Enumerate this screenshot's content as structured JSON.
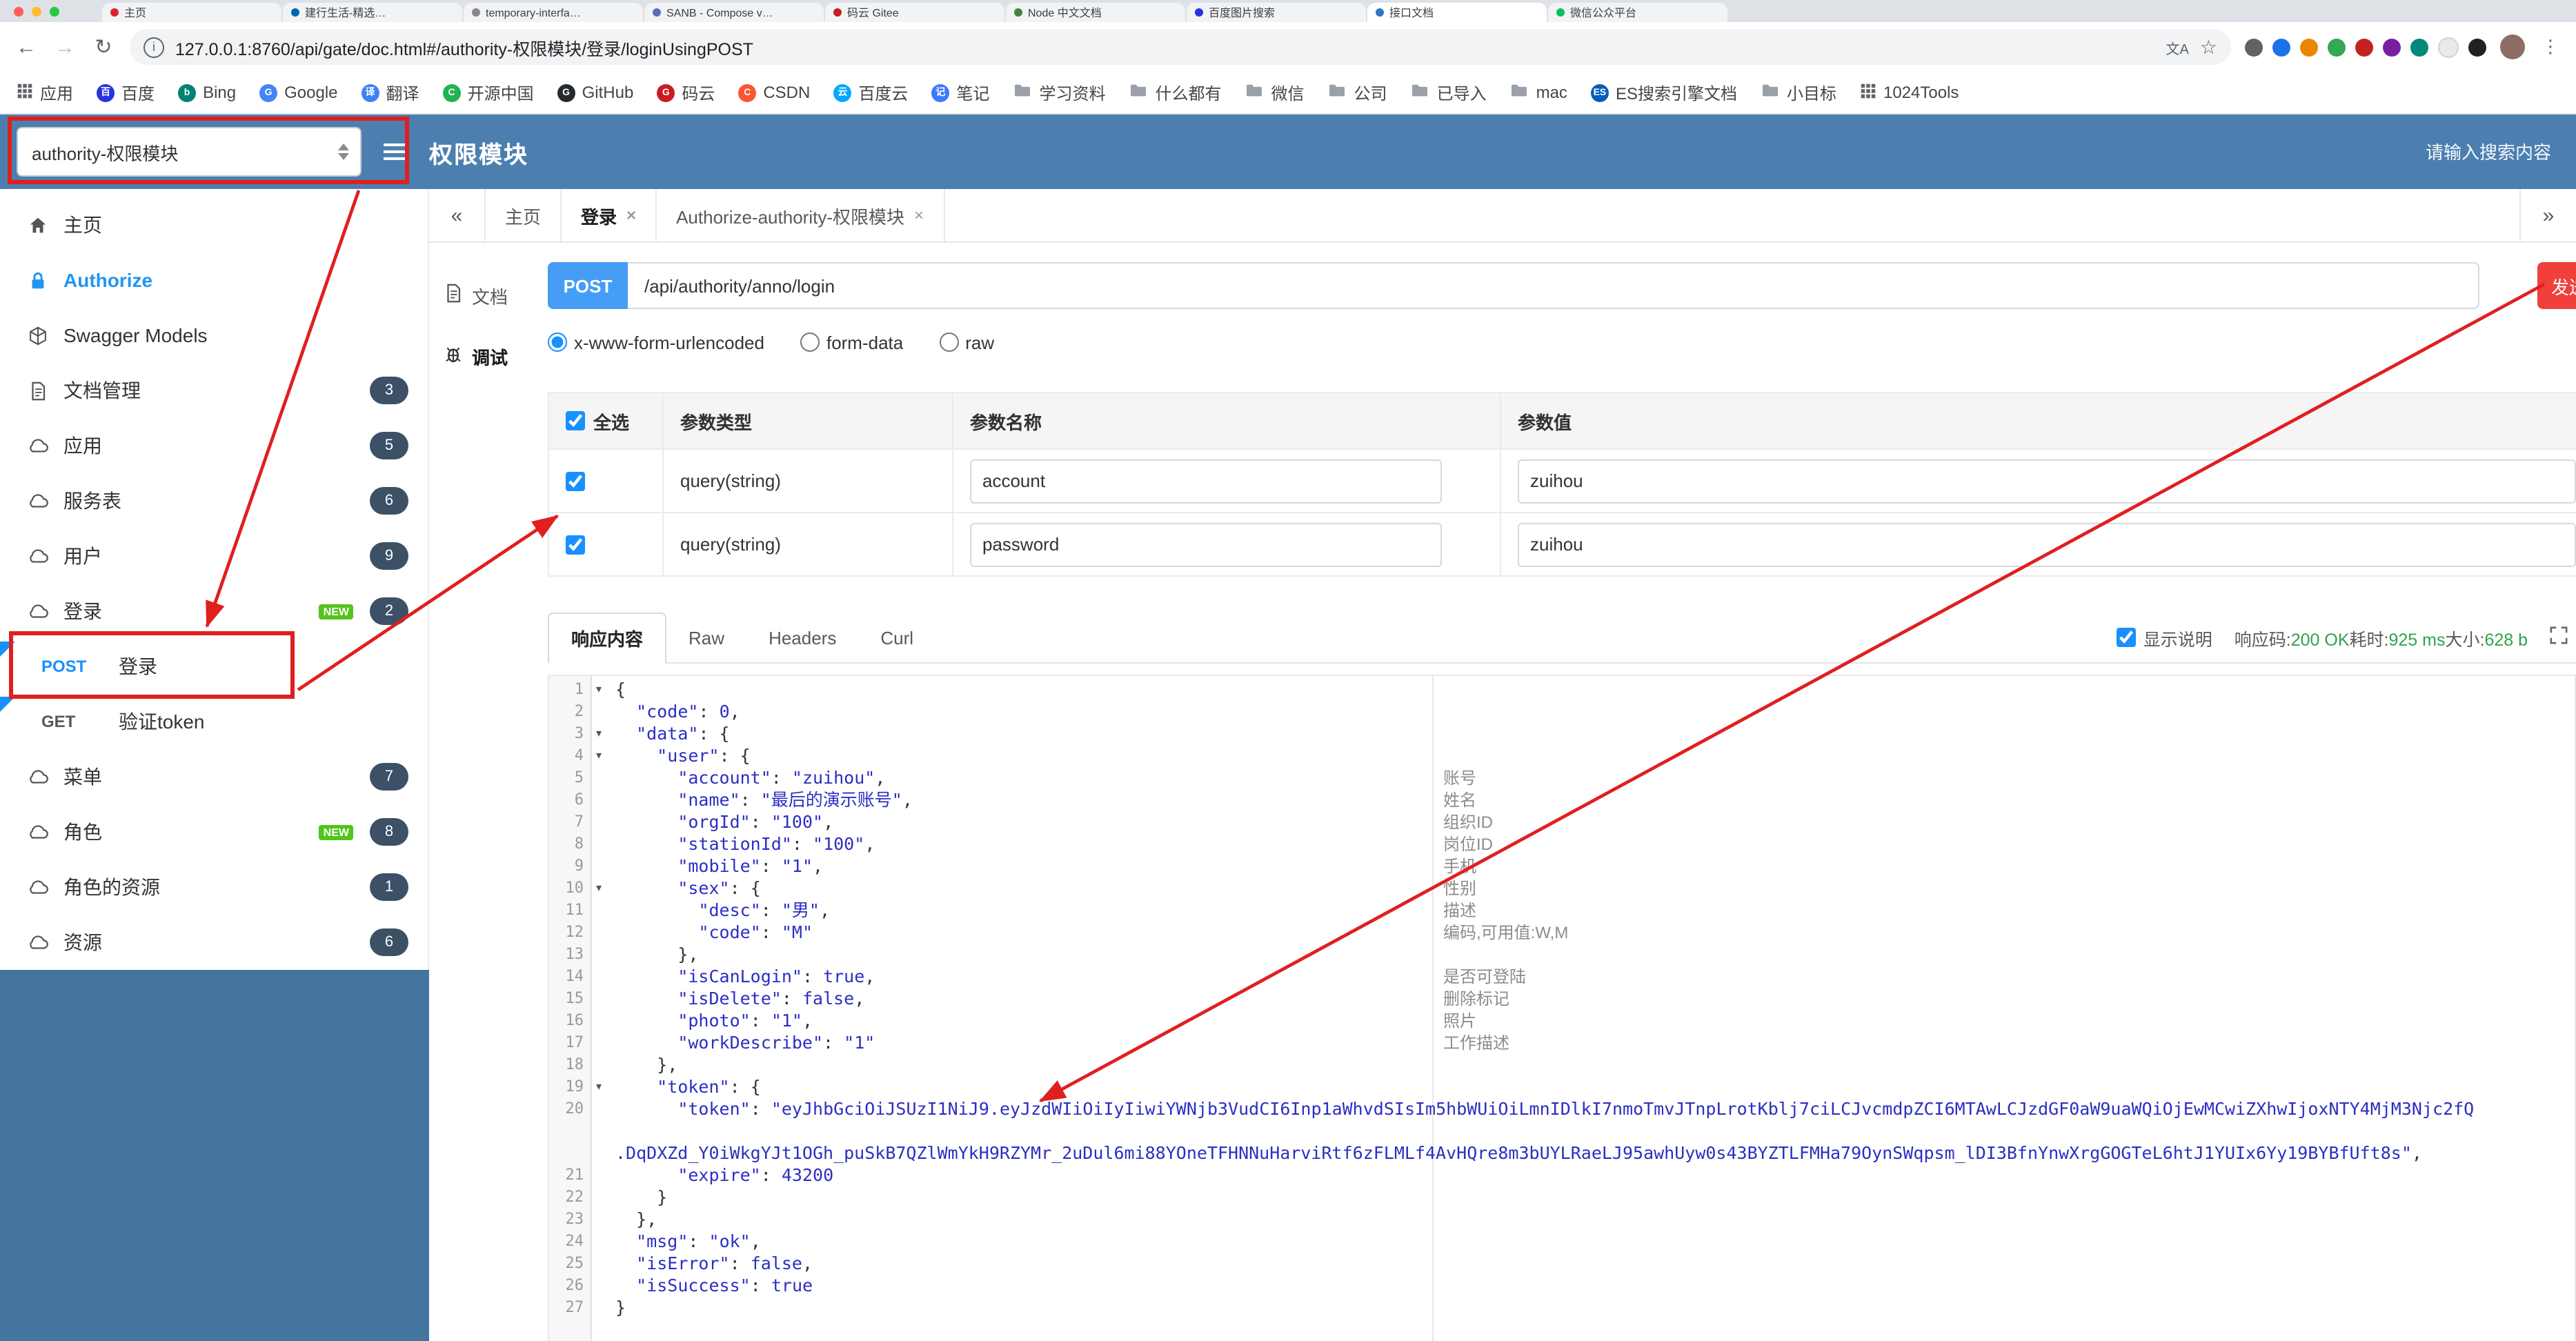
{
  "browser": {
    "tabs": [
      {
        "title": "主页",
        "color": "#d9232e"
      },
      {
        "title": "建行生活-精选…",
        "color": "#0066b3"
      },
      {
        "title": "temporary-interfa…",
        "color": "#888888"
      },
      {
        "title": "SANB - Compose v…",
        "color": "#5c6bc0"
      },
      {
        "title": "码云 Gitee",
        "color": "#c71d23"
      },
      {
        "title": "Node 中文文档",
        "color": "#43853d"
      },
      {
        "title": "百度图片搜索",
        "color": "#2932e1"
      },
      {
        "title": "接口文档",
        "color": "#2f77c0",
        "active": true
      },
      {
        "title": "微信公众平台",
        "color": "#07c160"
      }
    ],
    "address": {
      "url": "127.0.0.1:8760/api/gate/doc.html#/authority-权限模块/登录/loginUsingPOST"
    },
    "bookmarks": [
      {
        "label": "应用",
        "icon": "apps"
      },
      {
        "label": "百度",
        "icon": "letter",
        "letter": "百",
        "color": "#2932e1"
      },
      {
        "label": "Bing",
        "icon": "letter",
        "letter": "b",
        "color": "#008373"
      },
      {
        "label": "Google",
        "icon": "letter",
        "letter": "G",
        "color": "#4285f4"
      },
      {
        "label": "翻译",
        "icon": "letter",
        "letter": "译",
        "color": "#3b82f6"
      },
      {
        "label": "开源中国",
        "icon": "letter",
        "letter": "C",
        "color": "#21b351"
      },
      {
        "label": "GitHub",
        "icon": "letter",
        "letter": "G",
        "color": "#24292e"
      },
      {
        "label": "码云",
        "icon": "letter",
        "letter": "G",
        "color": "#c71d23"
      },
      {
        "label": "CSDN",
        "icon": "letter",
        "letter": "C",
        "color": "#fc5531"
      },
      {
        "label": "百度云",
        "icon": "letter",
        "letter": "云",
        "color": "#06a7ff"
      },
      {
        "label": "笔记",
        "icon": "letter",
        "letter": "记",
        "color": "#3a7afe"
      },
      {
        "label": "学习资料",
        "icon": "folder"
      },
      {
        "label": "什么都有",
        "icon": "folder"
      },
      {
        "label": "微信",
        "icon": "folder"
      },
      {
        "label": "公司",
        "icon": "folder"
      },
      {
        "label": "已导入",
        "icon": "folder"
      },
      {
        "label": "mac",
        "icon": "folder"
      },
      {
        "label": "ES搜索引擎文档",
        "icon": "letter",
        "letter": "ES",
        "color": "#005eb8"
      },
      {
        "label": "小目标",
        "icon": "folder"
      },
      {
        "label": "1024Tools",
        "icon": "apps"
      }
    ]
  },
  "header": {
    "select_value": "authority-权限模块",
    "title": "权限模块",
    "search_placeholder": "请输入搜索内容"
  },
  "sidebar": {
    "items": [
      {
        "label": "主页",
        "icon": "home"
      },
      {
        "label": "Authorize",
        "icon": "lock",
        "accent": true
      },
      {
        "label": "Swagger Models",
        "icon": "models"
      },
      {
        "label": "文档管理",
        "icon": "doc",
        "badge": "3"
      },
      {
        "label": "应用",
        "icon": "cloud",
        "badge": "5"
      },
      {
        "label": "服务表",
        "icon": "cloud",
        "badge": "6"
      },
      {
        "label": "用户",
        "icon": "cloud",
        "badge": "9"
      },
      {
        "label": "登录",
        "icon": "cloud",
        "badge": "2",
        "new": true
      },
      {
        "label": "登录",
        "method": "POST",
        "child": true,
        "flag": true
      },
      {
        "label": "验证token",
        "method": "GET",
        "child": true,
        "flag": true
      },
      {
        "label": "菜单",
        "icon": "cloud",
        "badge": "7"
      },
      {
        "label": "角色",
        "icon": "cloud",
        "badge": "8",
        "new": true
      },
      {
        "label": "角色的资源",
        "icon": "cloud",
        "badge": "1"
      },
      {
        "label": "资源",
        "icon": "cloud",
        "badge": "6"
      }
    ]
  },
  "doc_tabs": {
    "collapse": "«",
    "more": "»",
    "items": [
      {
        "label": "主页"
      },
      {
        "label": "登录",
        "closable": true,
        "active": true
      },
      {
        "label": "Authorize-authority-权限模块",
        "closable": true
      }
    ]
  },
  "side_tabs": [
    {
      "label": "文档",
      "icon": "doc"
    },
    {
      "label": "调试",
      "icon": "debug",
      "active": true
    }
  ],
  "request": {
    "method": "POST",
    "path": "/api/authority/anno/login",
    "send_label": "发送",
    "content_types": [
      {
        "label": "x-www-form-urlencoded",
        "checked": true
      },
      {
        "label": "form-data",
        "checked": false
      },
      {
        "label": "raw",
        "checked": false
      }
    ]
  },
  "params_table": {
    "headers": [
      "全选",
      "参数类型",
      "参数名称",
      "参数值"
    ],
    "rows": [
      {
        "checked": true,
        "type": "query(string)",
        "name": "account",
        "value": "zuihou"
      },
      {
        "checked": true,
        "type": "query(string)",
        "name": "password",
        "value": "zuihou"
      }
    ]
  },
  "response": {
    "tabs": [
      {
        "label": "响应内容",
        "active": true
      },
      {
        "label": "Raw"
      },
      {
        "label": "Headers"
      },
      {
        "label": "Curl"
      }
    ],
    "show_desc_label": "显示说明",
    "show_desc_checked": true,
    "meta": [
      {
        "label": "响应码:",
        "value": "200 OK"
      },
      {
        "label": "耗时:",
        "value": "925 ms"
      },
      {
        "label": "大小:",
        "value": "628 b"
      }
    ]
  },
  "editor": {
    "lines": [
      {
        "n": 1,
        "text": "{",
        "fold": true
      },
      {
        "n": 2,
        "text": "  \"code\": 0,"
      },
      {
        "n": 3,
        "text": "  \"data\": {",
        "fold": true
      },
      {
        "n": 4,
        "text": "    \"user\": {",
        "fold": true
      },
      {
        "n": 5,
        "text": "      \"account\": \"zuihou\",",
        "desc": "账号"
      },
      {
        "n": 6,
        "text": "      \"name\": \"最后的演示账号\",",
        "desc": "姓名"
      },
      {
        "n": 7,
        "text": "      \"orgId\": \"100\",",
        "desc": "组织ID"
      },
      {
        "n": 8,
        "text": "      \"stationId\": \"100\",",
        "desc": "岗位ID"
      },
      {
        "n": 9,
        "text": "      \"mobile\": \"1\",",
        "desc": "手机"
      },
      {
        "n": 10,
        "text": "      \"sex\": {",
        "fold": true,
        "desc": "性别"
      },
      {
        "n": 11,
        "text": "        \"desc\": \"男\",",
        "desc": "描述"
      },
      {
        "n": 12,
        "text": "        \"code\": \"M\"",
        "desc": "编码,可用值:W,M"
      },
      {
        "n": 13,
        "text": "      },"
      },
      {
        "n": 14,
        "text": "      \"isCanLogin\": true,",
        "desc": "是否可登陆"
      },
      {
        "n": 15,
        "text": "      \"isDelete\": false,",
        "desc": "删除标记"
      },
      {
        "n": 16,
        "text": "      \"photo\": \"1\",",
        "desc": "照片"
      },
      {
        "n": 17,
        "text": "      \"workDescribe\": \"1\"",
        "desc": "工作描述"
      },
      {
        "n": 18,
        "text": "    },"
      },
      {
        "n": 19,
        "text": "    \"token\": {",
        "fold": true
      },
      {
        "n": 20,
        "text": "      \"token\": \"eyJhbGciOiJSUzI1NiJ9.eyJzdWIiOiIyIiwiYWNjb3VudCI6Inp1aWhvdSIsIm5hbWUiOiLmnIDlkI7nmoTmvJTnpLrotKblj7ciLCJvcmdpZCI6MTAwLCJzdGF0aW9uaWQiOjEwMCwiZXhwIjoxNTY4MjM3Njc2fQ\n                .DqDXZd_Y0iWkgYJt1OGh_puSkB7QZlWmYkH9RZYMr_2uDul6mi88YOneTFHNNuHarviRtf6zFLMLf4AvHQre8m3bUYLRaeLJ95awhUyw0s43BYZTLFMHa79OynSWqpsm_lDI3BfnYnwXrgGOGTeL6htJ1YUIx6Yy19BYBfUft8s\","
      },
      {
        "n": 21,
        "text": "      \"expire\": 43200"
      },
      {
        "n": 22,
        "text": "    }"
      },
      {
        "n": 23,
        "text": "  },"
      },
      {
        "n": 24,
        "text": "  \"msg\": \"ok\","
      },
      {
        "n": 25,
        "text": "  \"isError\": false,"
      },
      {
        "n": 26,
        "text": "  \"isSuccess\": true"
      },
      {
        "n": 27,
        "text": "}"
      }
    ]
  }
}
